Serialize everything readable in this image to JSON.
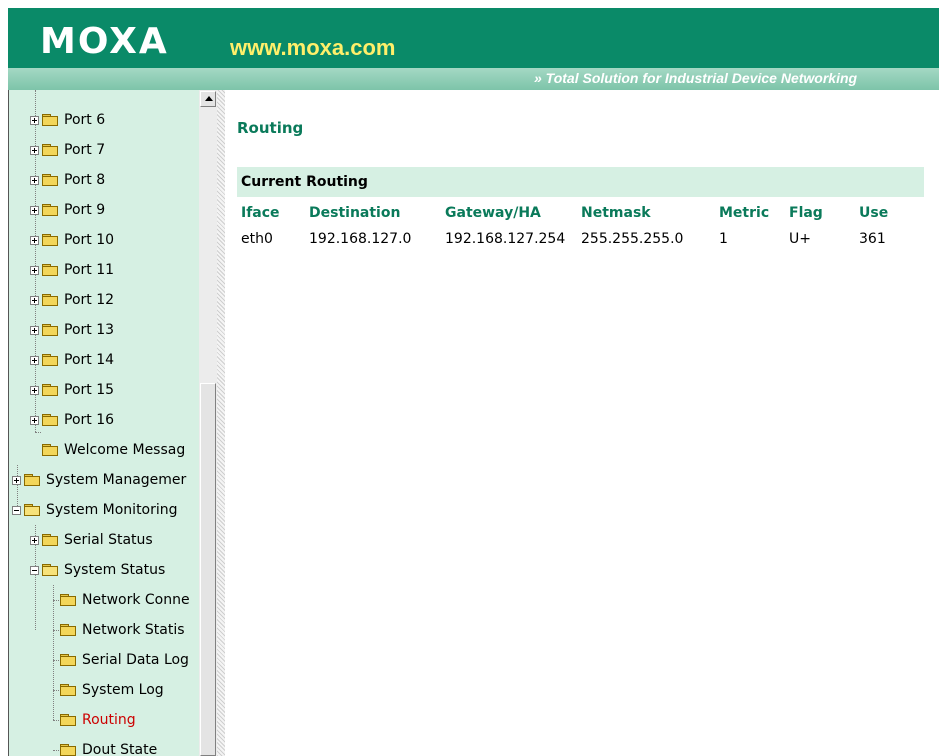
{
  "header": {
    "logo_text": "MOXA",
    "website": "www.moxa.com",
    "tagline": "» Total Solution for Industrial Device Networking",
    "colors": {
      "brand_green": "#0a8a68",
      "website_yellow": "#ffef6a"
    }
  },
  "sidebar": {
    "items": [
      {
        "label": "Port 6",
        "type": "collapsed"
      },
      {
        "label": "Port 7",
        "type": "collapsed"
      },
      {
        "label": "Port 8",
        "type": "collapsed"
      },
      {
        "label": "Port 9",
        "type": "collapsed"
      },
      {
        "label": "Port 10",
        "type": "collapsed"
      },
      {
        "label": "Port 11",
        "type": "collapsed"
      },
      {
        "label": "Port 12",
        "type": "collapsed"
      },
      {
        "label": "Port 13",
        "type": "collapsed"
      },
      {
        "label": "Port 14",
        "type": "collapsed"
      },
      {
        "label": "Port 15",
        "type": "collapsed"
      },
      {
        "label": "Port 16",
        "type": "collapsed"
      },
      {
        "label": "Welcome Messag",
        "type": "leaf"
      },
      {
        "label": "System Managemer",
        "type": "collapsed"
      },
      {
        "label": "System Monitoring",
        "type": "expanded"
      },
      {
        "label": "Serial Status",
        "type": "collapsed"
      },
      {
        "label": "System Status",
        "type": "expanded"
      },
      {
        "label": "Network Conne",
        "type": "leaf"
      },
      {
        "label": "Network Statis",
        "type": "leaf"
      },
      {
        "label": "Serial Data Log",
        "type": "leaf"
      },
      {
        "label": "System Log",
        "type": "leaf"
      },
      {
        "label": "Routing",
        "type": "leaf",
        "active": true
      },
      {
        "label": "Dout State",
        "type": "leaf"
      }
    ],
    "active_color": "#cc0000"
  },
  "main": {
    "title": "Routing",
    "section_title": "Current Routing",
    "table": {
      "columns": [
        "Iface",
        "Destination",
        "Gateway/HA",
        "Netmask",
        "Metric",
        "Flag",
        "Use"
      ],
      "rows": [
        [
          "eth0",
          "192.168.127.0",
          "192.168.127.254",
          "255.255.255.0",
          "1",
          "U+",
          "361"
        ]
      ]
    },
    "header_color": "#0a7a5a"
  }
}
